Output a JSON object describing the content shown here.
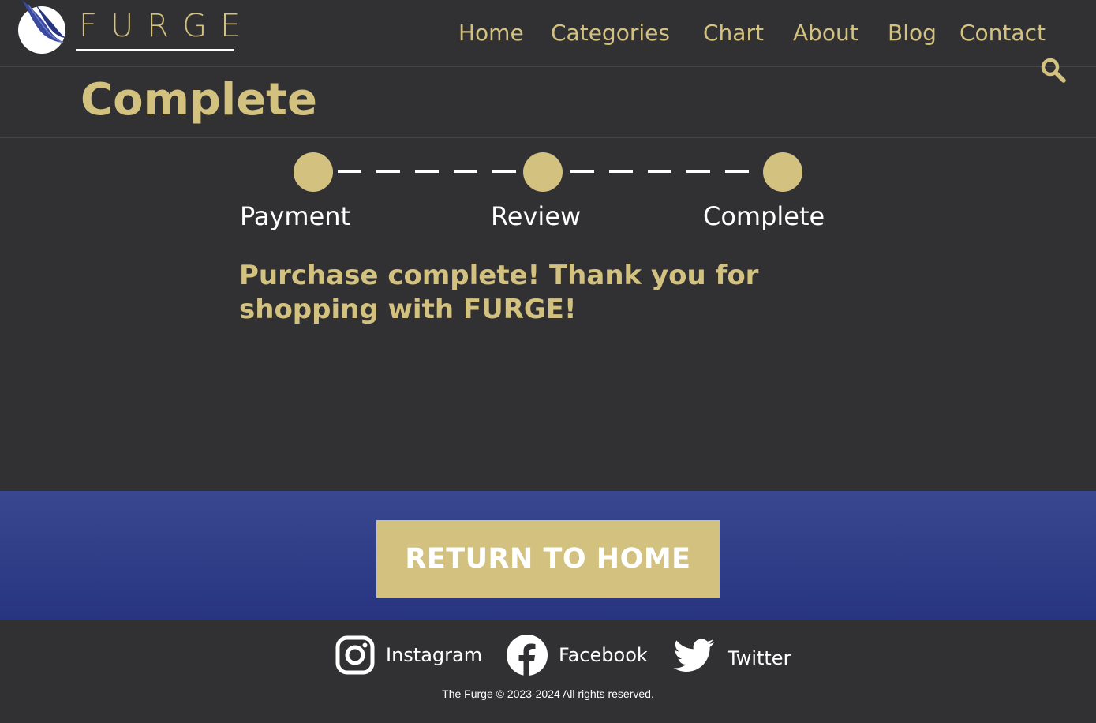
{
  "header": {
    "brand": "FURGE",
    "logo_icon": "furge-leaf-logo-icon",
    "nav": [
      "Home",
      "Categories",
      "Chart",
      "About",
      "Blog",
      "Contact"
    ],
    "search_icon": "search-icon"
  },
  "page": {
    "title": "Complete"
  },
  "stepper": {
    "steps": [
      "Payment",
      "Review",
      "Complete"
    ]
  },
  "message": "Purchase complete! Thank you for shopping with FURGE!",
  "cta": {
    "label": "RETURN TO HOME"
  },
  "footer": {
    "social": [
      {
        "label": "Instagram",
        "icon": "instagram-icon"
      },
      {
        "label": "Facebook",
        "icon": "facebook-icon"
      },
      {
        "label": "Twitter",
        "icon": "twitter-icon"
      }
    ],
    "copyright": "The Furge © 2023-2024 All rights reserved."
  },
  "colors": {
    "background": "#313133",
    "accent_gold": "#d2c17f",
    "band_blue": "#2f3d87",
    "text_white": "#ffffff",
    "logo_blue": "#3a4aa0"
  }
}
